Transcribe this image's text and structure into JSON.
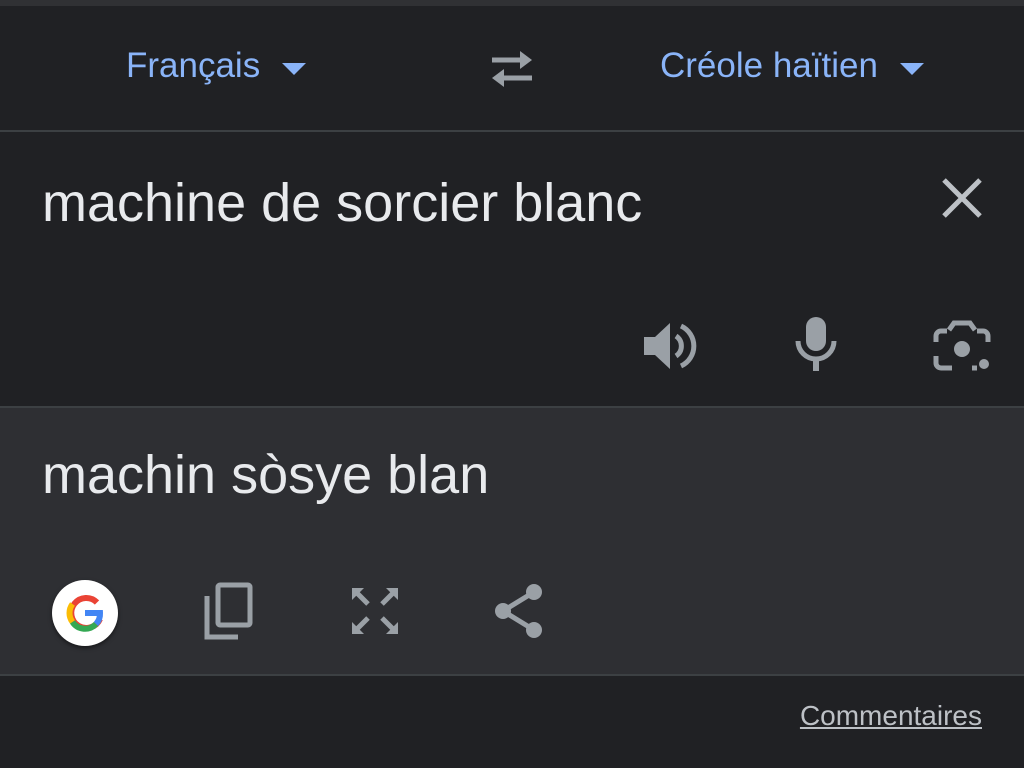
{
  "language_bar": {
    "source_language": "Français",
    "target_language": "Créole haïtien"
  },
  "input": {
    "source_text": "machine de sorcier blanc"
  },
  "output": {
    "translated_text": "machin sòsye blan"
  },
  "footer": {
    "feedback_label": "Commentaires"
  },
  "icons": {
    "swap": "swap-languages-icon",
    "clear": "close-icon",
    "speaker": "speaker-icon",
    "microphone": "microphone-icon",
    "camera": "camera-icon",
    "google": "google-logo-icon",
    "copy": "copy-icon",
    "fullscreen": "fullscreen-icon",
    "share": "share-icon"
  },
  "colors": {
    "accent": "#8ab4f8",
    "background": "#202124",
    "output_background": "#2e2f33",
    "text": "#e8eaed",
    "icon": "#9aa0a6"
  }
}
